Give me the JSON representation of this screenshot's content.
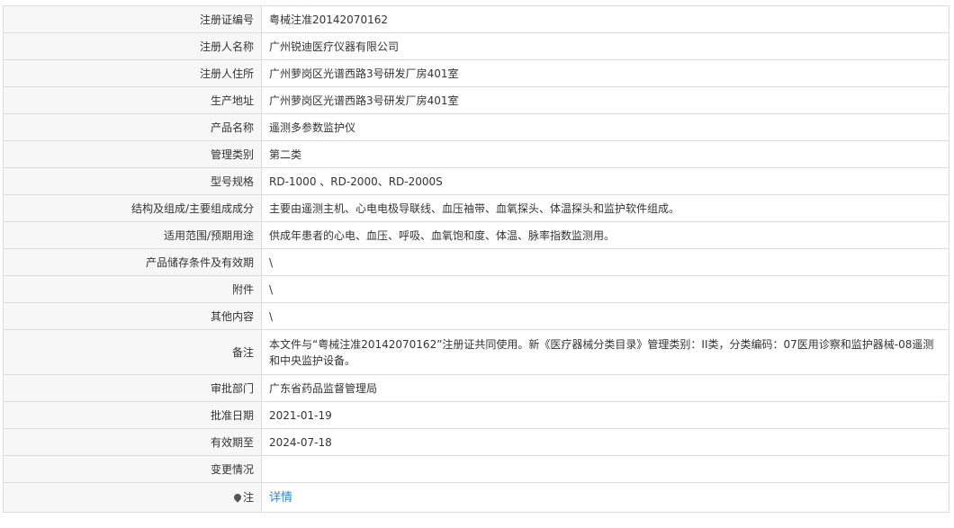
{
  "rows": [
    {
      "label": "注册证编号",
      "value": "粤械注准20142070162"
    },
    {
      "label": "注册人名称",
      "value": "广州锐迪医疗仪器有限公司"
    },
    {
      "label": "注册人住所",
      "value": "广州萝岗区光谱西路3号研发厂房401室"
    },
    {
      "label": "生产地址",
      "value": "广州萝岗区光谱西路3号研发厂房401室"
    },
    {
      "label": "产品名称",
      "value": "遥测多参数监护仪"
    },
    {
      "label": "管理类别",
      "value": "第二类"
    },
    {
      "label": "型号规格",
      "value": "RD-1000 、RD-2000、RD-2000S"
    },
    {
      "label": "结构及组成/主要组成成分",
      "value": "主要由遥测主机、心电电极导联线、血压袖带、血氧探头、体温探头和监护软件组成。"
    },
    {
      "label": "适用范围/预期用途",
      "value": "供成年患者的心电、血压、呼吸、血氧饱和度、体温、脉率指数监测用。"
    },
    {
      "label": "产品储存条件及有效期",
      "value": "\\"
    },
    {
      "label": "附件",
      "value": "\\"
    },
    {
      "label": "其他内容",
      "value": "\\"
    },
    {
      "label": "备注",
      "value": "本文件与“粤械注准20142070162”注册证共同使用。新《医疗器械分类目录》管理类别：II类，分类编码：07医用诊察和监护器械-08遥测和中央监护设备。"
    },
    {
      "label": "审批部门",
      "value": "广东省药品监督管理局"
    },
    {
      "label": "批准日期",
      "value": "2021-01-19"
    },
    {
      "label": "有效期至",
      "value": "2024-07-18"
    },
    {
      "label": "变更情况",
      "value": ""
    }
  ],
  "note": {
    "label": "注",
    "link_text": "详情",
    "icon": "pin-icon"
  },
  "colors": {
    "label_bg": "#f7f7f7",
    "border": "#dcdcdc",
    "link": "#2a8ad4"
  }
}
